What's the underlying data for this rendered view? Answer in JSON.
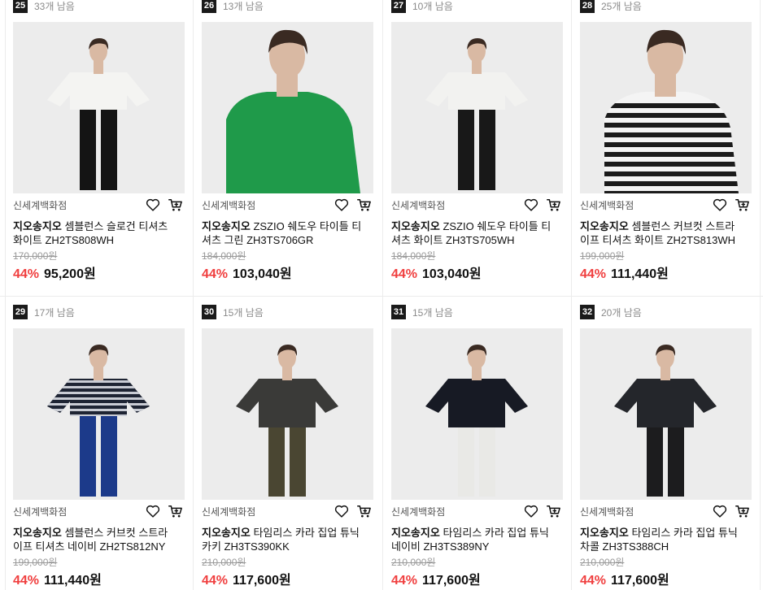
{
  "products": [
    {
      "rank": "25",
      "stock": "33개 남음",
      "store": "신세계백화점",
      "brand": "지오송지오",
      "name": "셈블런스 슬로건 티셔츠 화이트 ZH2TS808WH",
      "original_price": "170,000원",
      "discount": "44%",
      "price": "95,200원",
      "shirt_color": "#f4f4f2",
      "pants_color": "#141414",
      "style": "plain"
    },
    {
      "rank": "26",
      "stock": "13개 남음",
      "store": "신세계백화점",
      "brand": "지오송지오",
      "name": "ZSZIO 쉐도우 타이틀 티셔츠 그린 ZH3TS706GR",
      "original_price": "184,000원",
      "discount": "44%",
      "price": "103,040원",
      "shirt_color": "#1f9a4a",
      "pants_color": "#1f1f1f",
      "style": "closeup"
    },
    {
      "rank": "27",
      "stock": "10개 남음",
      "store": "신세계백화점",
      "brand": "지오송지오",
      "name": "ZSZIO 쉐도우 타이틀 티셔츠 화이트 ZH3TS705WH",
      "original_price": "184,000원",
      "discount": "44%",
      "price": "103,040원",
      "shirt_color": "#f2f2f0",
      "pants_color": "#181818",
      "style": "plain"
    },
    {
      "rank": "28",
      "stock": "25개 남음",
      "store": "신세계백화점",
      "brand": "지오송지오",
      "name": "셈블런스 커브컷 스트라이프 티셔츠 화이트 ZH2TS813WH",
      "original_price": "199,000원",
      "discount": "44%",
      "price": "111,440원",
      "shirt_color": "#f4f4f4",
      "pants_color": "#222222",
      "style": "stripe-closeup"
    },
    {
      "rank": "29",
      "stock": "17개 남음",
      "store": "신세계백화점",
      "brand": "지오송지오",
      "name": "셈블런스 커브컷 스트라이프 티셔츠 네이비 ZH2TS812NY",
      "original_price": "199,000원",
      "discount": "44%",
      "price": "111,440원",
      "shirt_color": "#1e2433",
      "pants_color": "#1c3a8a",
      "style": "stripe"
    },
    {
      "rank": "30",
      "stock": "15개 남음",
      "store": "신세계백화점",
      "brand": "지오송지오",
      "name": "타임리스 카라 집업 튜닉 카키 ZH3TS390KK",
      "original_price": "210,000원",
      "discount": "44%",
      "price": "117,600원",
      "shirt_color": "#3a3a38",
      "pants_color": "#4a4632",
      "style": "tunic"
    },
    {
      "rank": "31",
      "stock": "15개 남음",
      "store": "신세계백화점",
      "brand": "지오송지오",
      "name": "타임리스 카라 집업 튜닉 네이비 ZH3TS389NY",
      "original_price": "210,000원",
      "discount": "44%",
      "price": "117,600원",
      "shirt_color": "#171a24",
      "pants_color": "#e9e9e6",
      "style": "tunic"
    },
    {
      "rank": "32",
      "stock": "20개 남음",
      "store": "신세계백화점",
      "brand": "지오송지오",
      "name": "타임리스 카라 집업 튜닉 차콜 ZH3TS388CH",
      "original_price": "210,000원",
      "discount": "44%",
      "price": "117,600원",
      "shirt_color": "#24262b",
      "pants_color": "#1c1c1e",
      "style": "tunic"
    }
  ],
  "icons": {
    "wishlist": "heart-icon",
    "cart": "cart-icon"
  },
  "colors": {
    "discount": "#f03e3e",
    "rank_badge": "#1a1a1a",
    "photo_bg": "#ececec"
  }
}
